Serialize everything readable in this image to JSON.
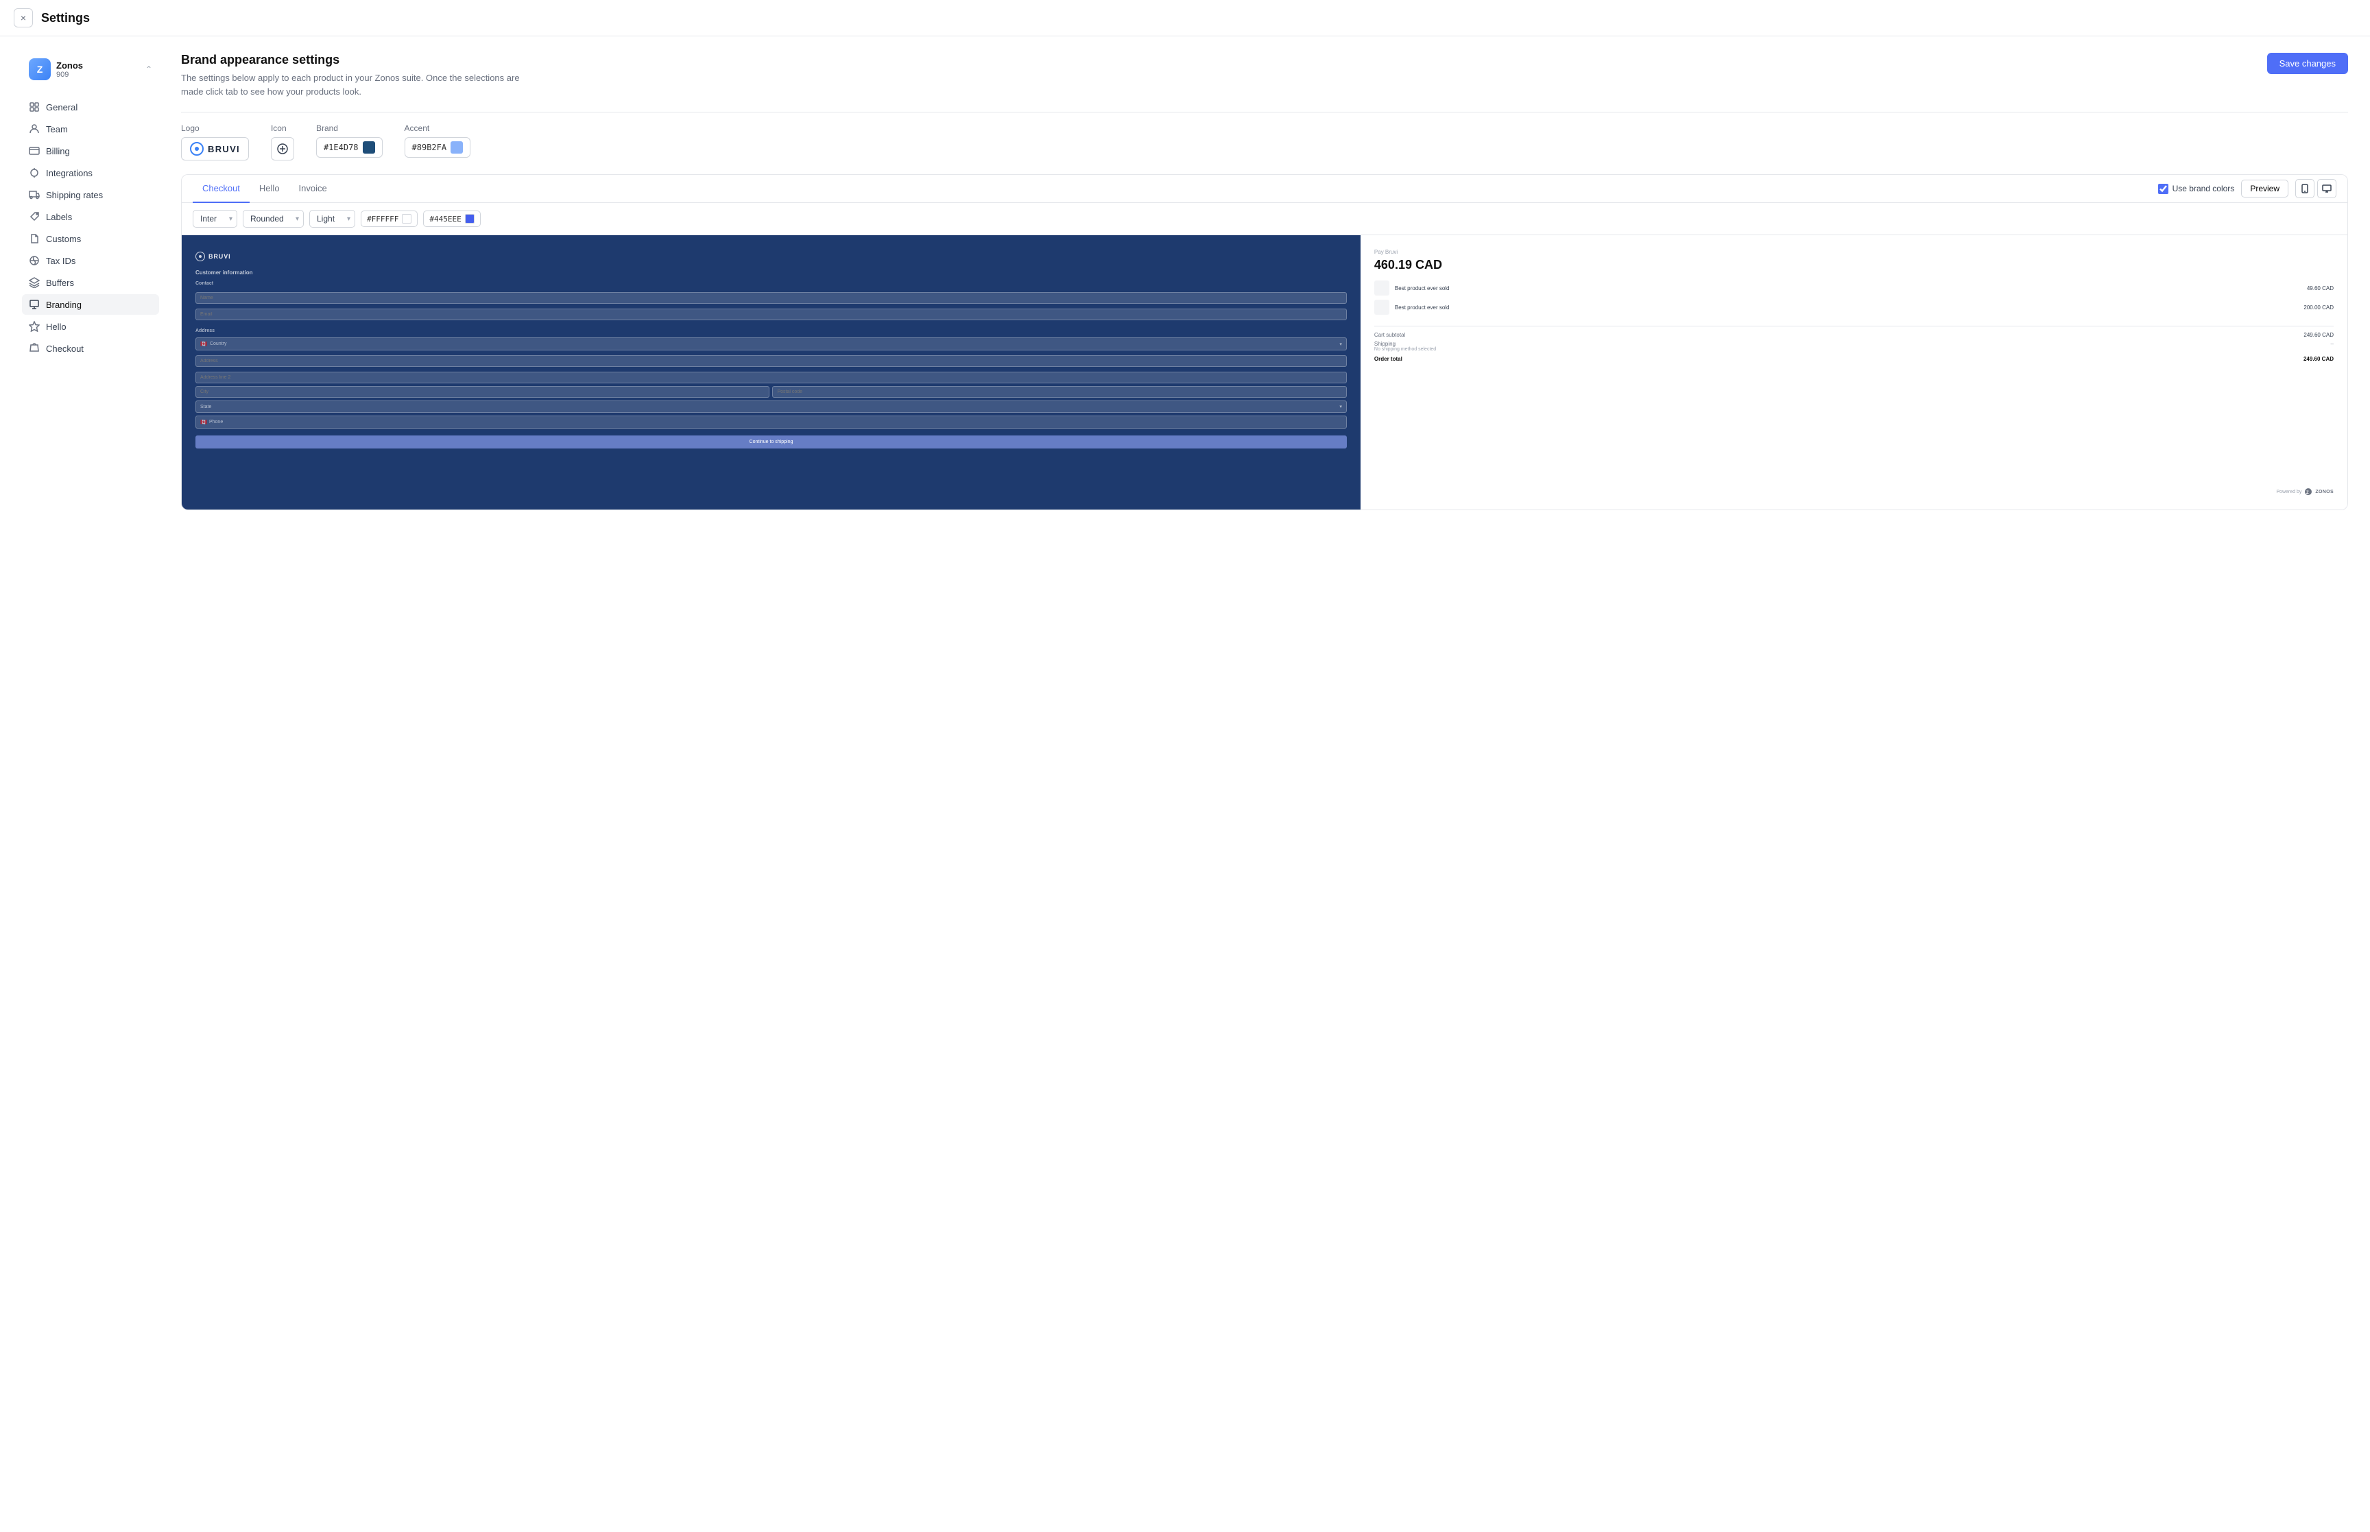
{
  "header": {
    "title": "Settings",
    "close_label": "×"
  },
  "sidebar": {
    "account": {
      "name": "Zonos",
      "id": "909",
      "avatar_letter": "Z"
    },
    "nav_items": [
      {
        "id": "general",
        "label": "General",
        "icon": "grid"
      },
      {
        "id": "team",
        "label": "Team",
        "icon": "user"
      },
      {
        "id": "billing",
        "label": "Billing",
        "icon": "credit-card"
      },
      {
        "id": "integrations",
        "label": "Integrations",
        "icon": "plug"
      },
      {
        "id": "shipping-rates",
        "label": "Shipping rates",
        "icon": "truck"
      },
      {
        "id": "labels",
        "label": "Labels",
        "icon": "tag"
      },
      {
        "id": "customs",
        "label": "Customs",
        "icon": "file"
      },
      {
        "id": "tax-ids",
        "label": "Tax IDs",
        "icon": "globe"
      },
      {
        "id": "buffers",
        "label": "Buffers",
        "icon": "layers"
      },
      {
        "id": "branding",
        "label": "Branding",
        "icon": "brush",
        "active": true
      },
      {
        "id": "hello",
        "label": "Hello",
        "icon": "star"
      },
      {
        "id": "checkout",
        "label": "Checkout",
        "icon": "shopping-bag"
      }
    ]
  },
  "content": {
    "title": "Brand appearance settings",
    "description": "The settings below apply to each product in your Zonos suite. Once the selections are made click tab to see how your products look.",
    "save_button": "Save changes",
    "brand_fields": {
      "logo_label": "Logo",
      "logo_text": "BRUVI",
      "icon_label": "Icon",
      "brand_label": "Brand",
      "brand_color": "#1E4D78",
      "accent_label": "Accent",
      "accent_color": "#89B2FA"
    },
    "tabs": [
      {
        "id": "checkout",
        "label": "Checkout",
        "active": true
      },
      {
        "id": "hello",
        "label": "Hello",
        "active": false
      },
      {
        "id": "invoice",
        "label": "Invoice",
        "active": false
      }
    ],
    "use_brand_colors": {
      "label": "Use brand colors",
      "checked": true
    },
    "preview_button": "Preview",
    "customize": {
      "font": "Inter",
      "style": "Rounded",
      "theme": "Light",
      "color1": "#FFFFFF",
      "color2": "#445EEE"
    },
    "checkout_preview": {
      "logo_text": "BRUVI",
      "section_title": "Customer information",
      "contact_label": "Contact",
      "name_placeholder": "Name",
      "email_placeholder": "Email",
      "address_label": "Address",
      "country_label": "Country",
      "address_placeholder": "Address",
      "address2_placeholder": "Address line 2",
      "city_placeholder": "City",
      "postal_placeholder": "Postal code",
      "state_label": "State",
      "phone_placeholder": "Phone",
      "continue_btn": "Continue to shipping",
      "pay_label": "Pay Bruvi",
      "amount": "460.19 CAD",
      "products": [
        {
          "name": "Best product ever sold",
          "price": "49.60 CAD"
        },
        {
          "name": "Best product ever sold",
          "price": "200.00 CAD"
        }
      ],
      "cart_subtotal_label": "Cart subtotal",
      "cart_subtotal_value": "249.60 CAD",
      "shipping_label": "Shipping",
      "shipping_value": "–",
      "shipping_note": "No shipping method selected",
      "order_total_label": "Order total",
      "order_total_value": "249.60 CAD",
      "powered_by": "Powered by"
    }
  }
}
